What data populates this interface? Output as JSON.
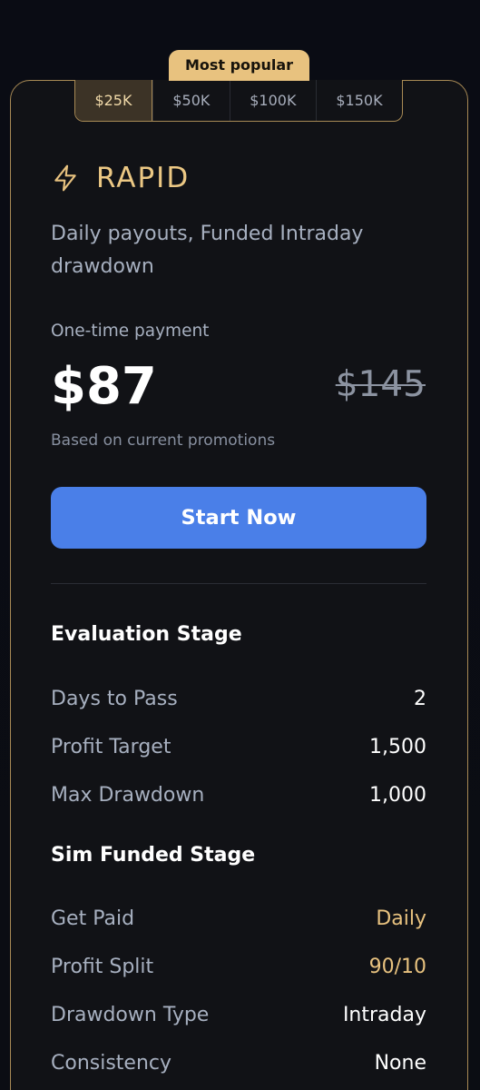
{
  "badge": "Most popular",
  "tabs": [
    {
      "label": "$25K",
      "active": true
    },
    {
      "label": "$50K",
      "active": false
    },
    {
      "label": "$100K",
      "active": false
    },
    {
      "label": "$150K",
      "active": false
    }
  ],
  "plan": {
    "icon": "lightning-bolt-icon",
    "name": "RAPID",
    "description": "Daily payouts, Funded Intraday drawdown",
    "payment_label": "One-time payment",
    "price": "$87",
    "original_price": "$145",
    "promo_note": "Based on current promotions",
    "cta_label": "Start Now"
  },
  "evaluation": {
    "heading": "Evaluation Stage",
    "rows": [
      {
        "key": "Days to Pass",
        "value": "2"
      },
      {
        "key": "Profit Target",
        "value": "1,500"
      },
      {
        "key": "Max Drawdown",
        "value": "1,000"
      }
    ]
  },
  "funded": {
    "heading": "Sim Funded Stage",
    "rows": [
      {
        "key": "Get Paid",
        "value": "Daily",
        "highlight": true
      },
      {
        "key": "Profit Split",
        "value": "90/10",
        "highlight": true
      },
      {
        "key": "Drawdown Type",
        "value": "Intraday",
        "highlight": false
      },
      {
        "key": "Consistency",
        "value": "None",
        "highlight": false
      }
    ]
  },
  "colors": {
    "accent_gold": "#e8c27f",
    "cta_blue": "#4a7fe8",
    "card_bg": "#111216",
    "border_gold": "#a88a55"
  }
}
